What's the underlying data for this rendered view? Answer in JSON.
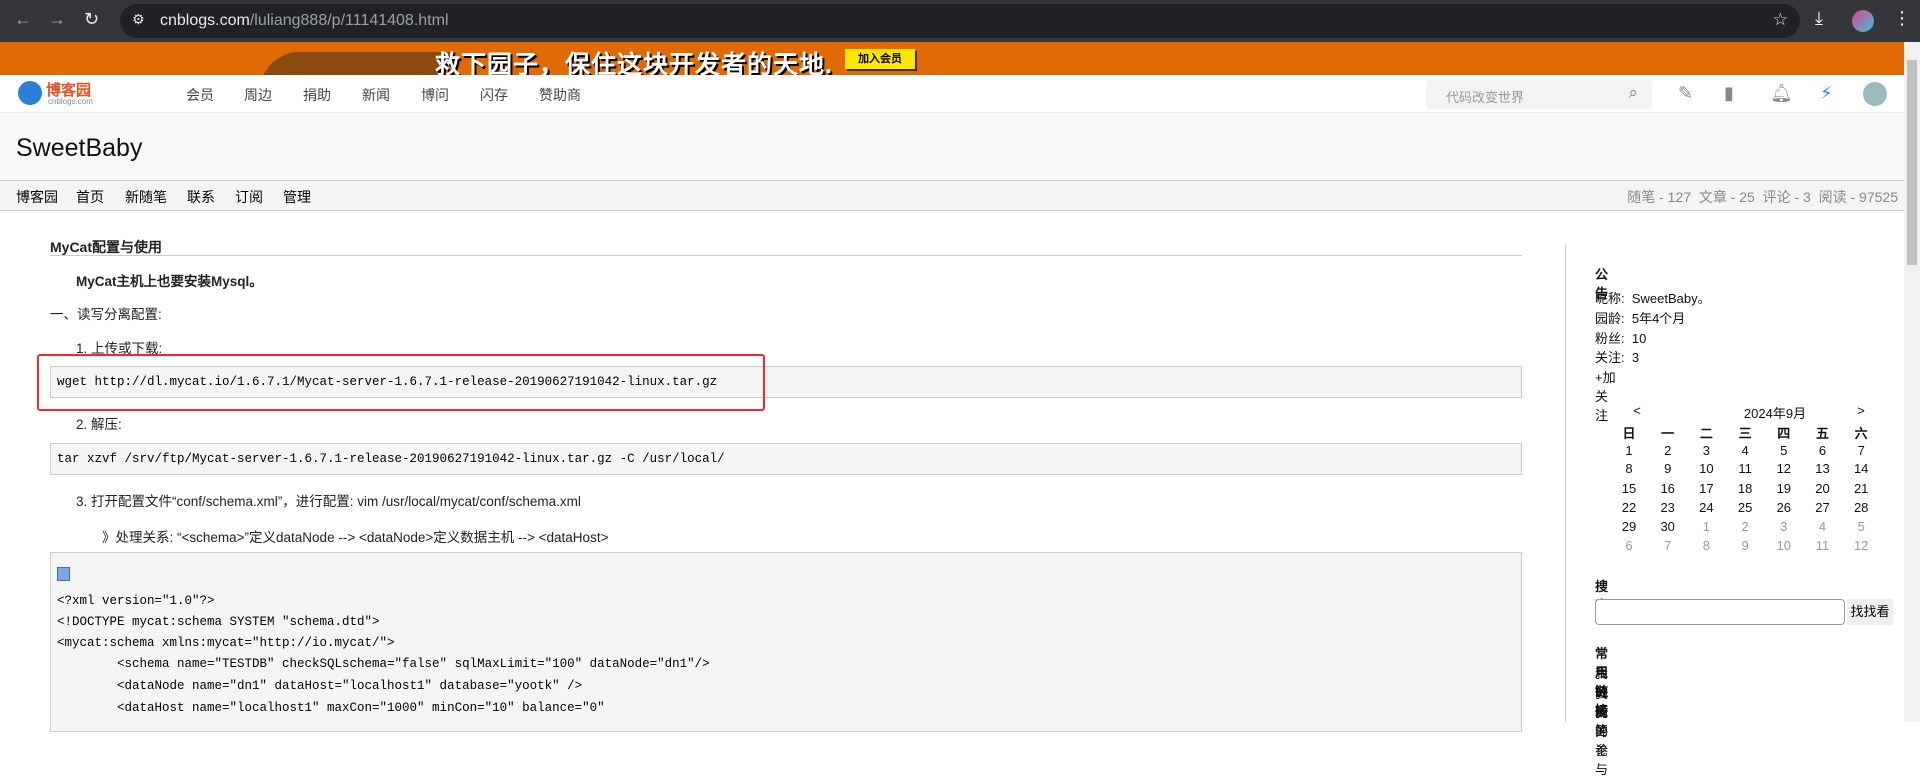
{
  "browser": {
    "url_domain": "cnblogs.com",
    "url_path": "/luliang888/p/11141408.html"
  },
  "banner": {
    "slogan": "救下园子，保住这块开发者的天地.",
    "join": "加入会员"
  },
  "site": {
    "logo": "博客园",
    "logo_sub": "cnblogs.com",
    "nav": [
      "会员",
      "周边",
      "捐助",
      "新闻",
      "博问",
      "闪存",
      "赞助商"
    ],
    "search_placeholder": "代码改变世界"
  },
  "blog": {
    "title": "SweetBaby",
    "nav": [
      "博客园",
      "首页",
      "新随笔",
      "联系",
      "订阅",
      "管理"
    ],
    "stats": "随笔 - 127  文章 - 25  评论 - 3  阅读 - 97525"
  },
  "post": {
    "title": "MyCat配置与使用",
    "intro": "MyCat主机上也要安装Mysql。",
    "section1": "一、读写分离配置:",
    "step1": "1. 上传或下载:",
    "code1": "wget http://dl.mycat.io/1.6.7.1/Mycat-server-1.6.7.1-release-20190627191042-linux.tar.gz",
    "step2": "2. 解压:",
    "code2": "tar xzvf /srv/ftp/Mycat-server-1.6.7.1-release-20190627191042-linux.tar.gz -C /usr/local/",
    "step3": "3. 打开配置文件“conf/schema.xml”，进行配置: vim /usr/local/mycat/conf/schema.xml",
    "relation": "》处理关系: “<schema>”定义dataNode --> <dataNode>定义数据主机 --> <dataHost>",
    "code3": [
      "<?xml version=\"1.0\"?>",
      "<!DOCTYPE mycat:schema SYSTEM \"schema.dtd\">",
      "<mycat:schema xmlns:mycat=\"http://io.mycat/\">",
      "        <schema name=\"TESTDB\" checkSQLschema=\"false\" sqlMaxLimit=\"100\" dataNode=\"dn1\"/>",
      "        <dataNode name=\"dn1\" dataHost=\"localhost1\" database=\"yootk\" />",
      "        <dataHost name=\"localhost1\" maxCon=\"1000\" minCon=\"10\" balance=\"0\""
    ]
  },
  "sidebar": {
    "notice_title": "公告",
    "profile": [
      "昵称:  SweetBaby。",
      "园龄:  5年4个月",
      "粉丝:  10",
      "关注:  3"
    ],
    "follow": "+加关注",
    "calendar": {
      "prev": "<",
      "month": "2024年9月",
      "next": ">",
      "weekdays": [
        "日",
        "一",
        "二",
        "三",
        "四",
        "五",
        "六"
      ],
      "rows": [
        [
          "1",
          "2",
          "3",
          "4",
          "5",
          "6",
          "7"
        ],
        [
          "8",
          "9",
          "10",
          "11",
          "12",
          "13",
          "14"
        ],
        [
          "15",
          "16",
          "17",
          "18",
          "19",
          "20",
          "21"
        ],
        [
          "22",
          "23",
          "24",
          "25",
          "26",
          "27",
          "28"
        ],
        [
          "29",
          "30",
          "1",
          "2",
          "3",
          "4",
          "5"
        ],
        [
          "6",
          "7",
          "8",
          "9",
          "10",
          "11",
          "12"
        ]
      ]
    },
    "search_title": "搜索",
    "search_button": "找找看",
    "links_title": "常用链接",
    "links": [
      "我的随笔",
      "我的评论",
      "我的参与"
    ]
  }
}
